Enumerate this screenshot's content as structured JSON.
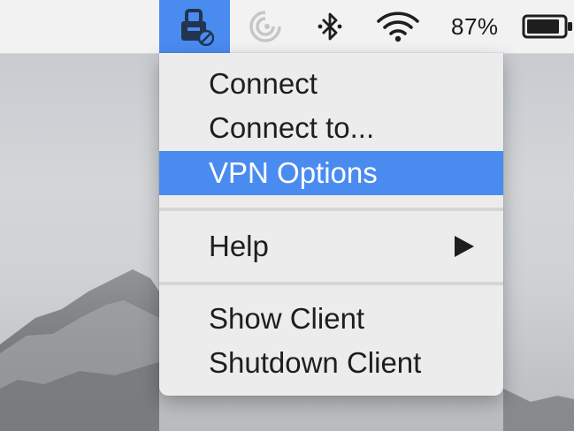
{
  "menubar": {
    "icons": {
      "vpn": "vpn-lock-icon",
      "dial": "signal-dial-icon",
      "bluetooth": "bluetooth-icon",
      "wifi": "wifi-icon",
      "battery": "battery-icon"
    },
    "battery_percent": "87%"
  },
  "menu": {
    "items": [
      {
        "label": "Connect"
      },
      {
        "label": "Connect to..."
      },
      {
        "label": "VPN Options",
        "highlighted": true
      },
      {
        "label": "Help",
        "submenu": true
      },
      {
        "label": "Show Client"
      },
      {
        "label": "Shutdown Client"
      }
    ]
  },
  "colors": {
    "highlight": "#4a8bf0",
    "menu_bg": "#ececec",
    "menubar_bg": "#f2f2f2"
  }
}
